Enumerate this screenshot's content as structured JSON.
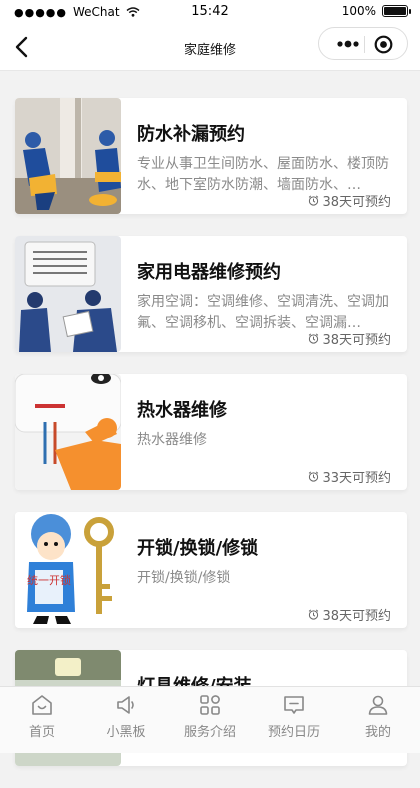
{
  "status_bar": {
    "signal_dots": "●●●●●",
    "carrier": "WeChat",
    "time": "15:42",
    "battery": "100%",
    "battery_level": 1.0
  },
  "nav": {
    "title": "家庭维修",
    "icons": [
      "back-arrow-icon",
      "more-icon",
      "target-icon"
    ]
  },
  "services": [
    {
      "title": "防水补漏预约",
      "desc": "专业从事卫生间防水、屋面防水、楼顶防水、地下室防水防潮、墙面防水、…",
      "availability": "38天可预约"
    },
    {
      "title": "家用电器维修预约",
      "desc": "家用空调：空调维修、空调清洗、空调加氟、空调移机、空调拆装、空调漏…",
      "availability": "38天可预约"
    },
    {
      "title": "热水器维修",
      "desc": "热水器维修",
      "availability": "33天可预约"
    },
    {
      "title": "开锁/换锁/修锁",
      "desc": "开锁/换锁/修锁",
      "availability": "38天可预约",
      "image_text": "统一开锁"
    },
    {
      "title": "灯具维修/安装",
      "desc": "",
      "availability": ""
    }
  ],
  "tabbar": [
    {
      "label": "首页",
      "icon": "home-icon"
    },
    {
      "label": "小黑板",
      "icon": "megaphone-icon"
    },
    {
      "label": "服务介绍",
      "icon": "grid-icon"
    },
    {
      "label": "预约日历",
      "icon": "message-icon"
    },
    {
      "label": "我的",
      "icon": "user-icon"
    }
  ],
  "colors": {
    "accent_orange": "#f5902e",
    "muted_text": "#8a8a8a",
    "page_bg": "#f2f2f2"
  }
}
